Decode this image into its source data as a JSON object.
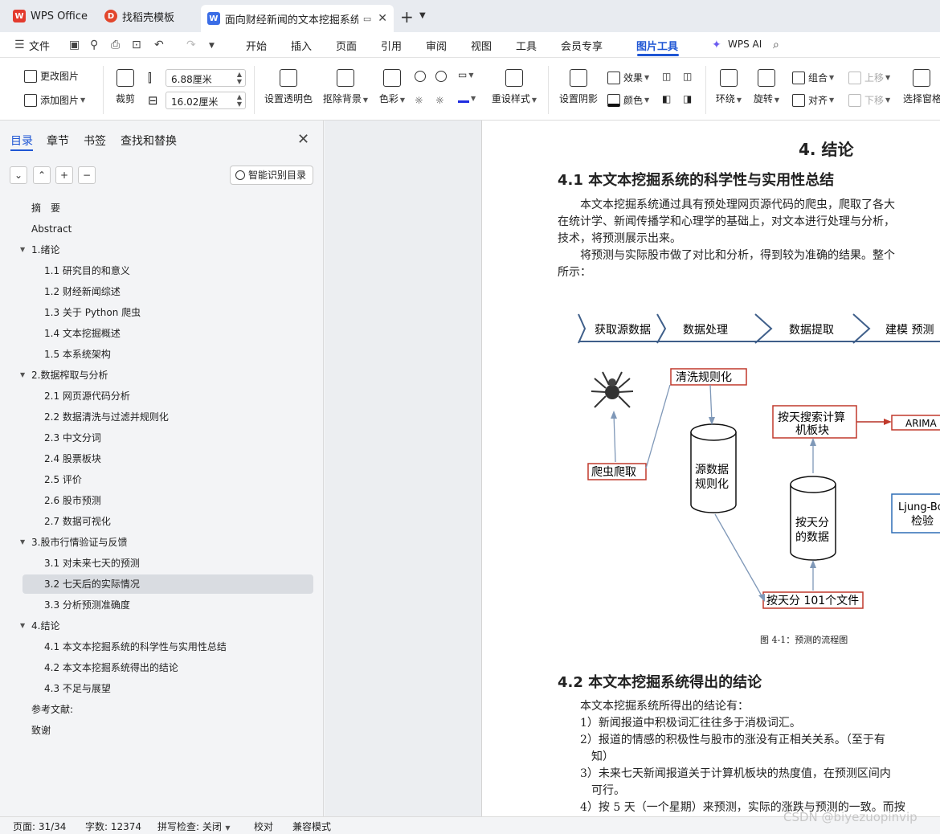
{
  "tabs": {
    "wps": "WPS Office",
    "template": "找稻壳模板",
    "doc": "面向财经新闻的文本挖掘系统设计"
  },
  "menu": {
    "file": "文件",
    "items": [
      "开始",
      "插入",
      "页面",
      "引用",
      "审阅",
      "视图",
      "工具",
      "会员专享",
      "图片工具"
    ],
    "wps_ai": "WPS AI"
  },
  "ribbon": {
    "change_image": "更改图片",
    "add_image": "添加图片",
    "crop": "裁剪",
    "width_value": "6.88厘米",
    "height_value": "16.02厘米",
    "transparent": "设置透明色",
    "remove_bg": "抠除背景",
    "color_adjust": "色彩",
    "reset_style": "重设样式",
    "shadow": "设置阴影",
    "effect": "效果",
    "color": "颜色",
    "wrap": "环绕",
    "rotate": "旋转",
    "group": "组合",
    "align": "对齐",
    "move_up": "上移",
    "move_down": "下移",
    "selection_pane": "选择窗格"
  },
  "sidebar": {
    "tabs": [
      "目录",
      "章节",
      "书签",
      "查找和替换"
    ],
    "smart_toc": "智能识别目录",
    "toc": [
      {
        "text": "摘　要"
      },
      {
        "text": "Abstract"
      },
      {
        "text": "1.绪论"
      },
      {
        "text": "1.1  研究目的和意义"
      },
      {
        "text": "1.2  财经新闻综述"
      },
      {
        "text": "1.3  关于 Python 爬虫"
      },
      {
        "text": "1.4  文本挖掘概述"
      },
      {
        "text": "1.5 本系统架构"
      },
      {
        "text": "2.数据榨取与分析"
      },
      {
        "text": "2.1  网页源代码分析"
      },
      {
        "text": "2.2  数据清洗与过滤并规则化"
      },
      {
        "text": "2.3  中文分词"
      },
      {
        "text": "2.4  股票板块"
      },
      {
        "text": "2.5  评价"
      },
      {
        "text": "2.6  股市预测"
      },
      {
        "text": "2.7  数据可视化"
      },
      {
        "text": "3.股市行情验证与反馈"
      },
      {
        "text": "3.1  对未来七天的预测"
      },
      {
        "text": "3.2  七天后的实际情况"
      },
      {
        "text": "3.3  分析预测准确度"
      },
      {
        "text": "4.结论"
      },
      {
        "text": "4.1  本文本挖掘系统的科学性与实用性总结"
      },
      {
        "text": "4.2  本文本挖掘系统得出的结论"
      },
      {
        "text": "4.3  不足与展望"
      },
      {
        "text": "参考文献:"
      },
      {
        "text": "致谢"
      }
    ]
  },
  "document": {
    "chapter_title": "4. 结论",
    "s41_title": "4.1  本文本挖掘系统的科学性与实用性总结",
    "s41_lines": [
      "　　本文本挖掘系统通过具有预处理网页源代码的爬虫，爬取了各大",
      "在统计学、新闻传播学和心理学的基础上，对文本进行处理与分析，",
      "技术，将预测展示出来。",
      "　　将预测与实际股市做了对比和分析，得到较为准确的结果。整个",
      "所示："
    ],
    "figure": {
      "stages": [
        "获取源数据",
        "数据处理",
        "数据提取",
        "建模 预测"
      ],
      "nodes": {
        "clean": "清洗规则化",
        "crawl": "爬虫爬取",
        "source1": "源数据",
        "source2": "规则化",
        "daily1": "按天分",
        "daily2": "的数据",
        "calc1": "按天搜索计算",
        "calc2": "机板块",
        "files": "按天分 101个文件",
        "arima": "ARIMA",
        "ljung1": "Ljung-Bo",
        "ljung2": "检验"
      },
      "caption": "图 4-1：预测的流程图"
    },
    "s42_title": "4.2  本文本挖掘系统得出的结论",
    "s42_lines": [
      "　　本文本挖掘系统所得出的结论有：",
      "　　1）新闻报道中积极词汇往往多于消极词汇。",
      "　　2）报道的情感的积极性与股市的涨没有正相关关系。（至于有",
      "　　　知）",
      "　　3）未来七天新闻报道关于计算机板块的热度值，在预测区间内",
      "　　　可行。",
      "　　4）按 5 天（一个星期）来预测，实际的涨跌与预测的一致。而按"
    ]
  },
  "status": {
    "page": "页面: 31/34",
    "words": "字数: 12374",
    "spell": "拼写检查: 关闭",
    "proof": "校对",
    "compat": "兼容模式"
  },
  "watermark": "CSDN @biyezuopinvip"
}
